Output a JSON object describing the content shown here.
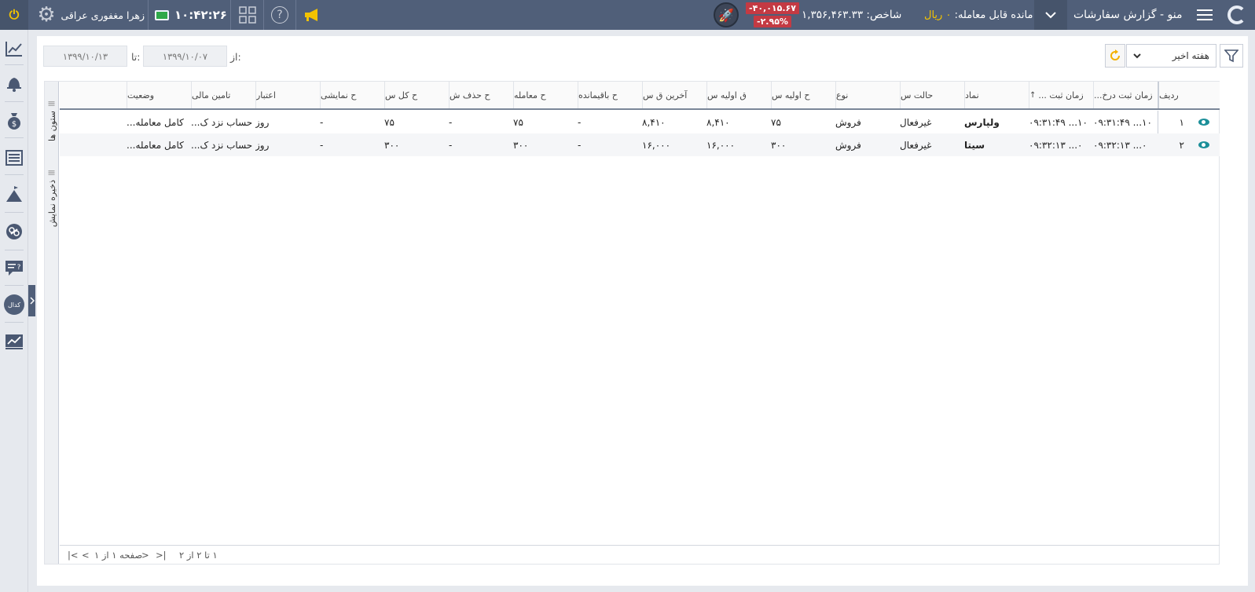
{
  "app": {
    "title": "منو - گزارش سفارشات",
    "user_name": "زهرا مغفوری عراقی",
    "clock": "۱۰:۴۲:۲۶",
    "balance_label": "مانده قابل معامله:",
    "balance_value": "۰ ریال",
    "index_text": "شاخص: ۱,۳۵۶,۴۶۳.۳۳",
    "index_change": "-۴۰,۰۱۵.۶۷",
    "index_change_pct": "-۲.۹۵%",
    "accent_color": "#f3c300",
    "topbar_color": "#505f79",
    "negative_color": "#c43a43"
  },
  "filters": {
    "from_label": "از:",
    "from_date": "۱۳۹۹/۱۰/۰۷",
    "to_label": "تا:",
    "to_date": "۱۳۹۹/۱۰/۱۳",
    "period": "هفته اخیر"
  },
  "side_tabs": {
    "columns": "ستون ها",
    "save_layout": "ذخیره نمایش"
  },
  "table": {
    "headers": [
      "ردیف",
      "زمان ثبت درخ...",
      "زمان ثبت ...",
      "نماد",
      "حالت س",
      "نوع",
      "ح اولیه س",
      "ق اولیه س",
      "آخرین ق س",
      "ح باقیمانده",
      "ح معامله",
      "ح حذف ش",
      "ح کل س",
      "ح نمایشی",
      "اعتبار",
      "تامین مالی",
      "وضعیت"
    ],
    "rows": [
      [
        "۱",
        "۱۰... ۰۹:۳۱:۴۹",
        "۱۰... ۰۹:۳۱:۴۹",
        "ولپارس",
        "غیرفعال",
        "فروش",
        "۷۵",
        "۸,۴۱۰",
        "۸,۴۱۰",
        "-",
        "۷۵",
        "-",
        "۷۵",
        "-",
        "روز",
        "حساب نزد ک...",
        "کامل معامله..."
      ],
      [
        "۲",
        "۰... ۰۹:۳۲:۱۳",
        "۰... ۰۹:۳۲:۱۳",
        "سیتا",
        "غیرفعال",
        "فروش",
        "۳۰۰",
        "۱۶,۰۰۰",
        "۱۶,۰۰۰",
        "-",
        "۳۰۰",
        "-",
        "۳۰۰",
        "-",
        "روز",
        "حساب نزد ک...",
        "کامل معامله..."
      ]
    ]
  },
  "pager": {
    "range": "۱ تا ۲ از ۲",
    "page": "صفحه ۱ از ۱"
  },
  "icons": {
    "power": "power-icon",
    "settings": "gear-icon",
    "monitor": "monitor-icon",
    "layout": "grid-icon",
    "help": "help-icon",
    "announce": "megaphone-icon",
    "rocket": "rocket-icon",
    "menu": "hamburger-icon",
    "filter": "filter-icon",
    "refresh": "refresh-icon",
    "view": "eye-icon"
  }
}
